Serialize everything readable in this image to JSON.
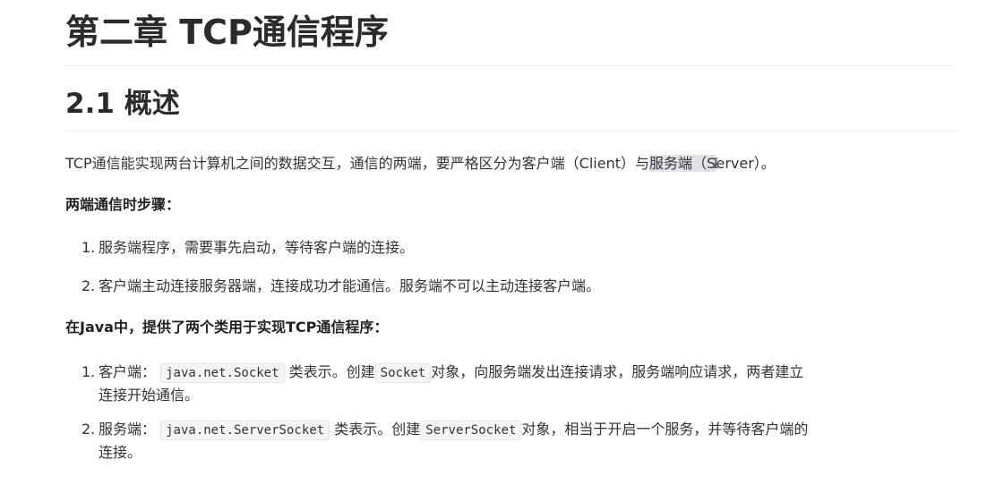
{
  "doc": {
    "chapter_title": "第二章 TCP通信程序",
    "section_title": "2.1 概述",
    "intro": {
      "before": "TCP通信能实现两台计算机之间的数据交互，通信的两端，要严格区分为客户端（Client）与",
      "highlight": "服务端（S",
      "cursor": "I",
      "after": "erver）。"
    },
    "steps_heading": "两端通信时步骤：",
    "steps": [
      {
        "num": "1.",
        "text": "服务端程序，需要事先启动，等待客户端的连接。"
      },
      {
        "num": "2.",
        "text": "客户端主动连接服务器端，连接成功才能通信。服务端不可以主动连接客户端。"
      }
    ],
    "java_heading": "在Java中，提供了两个类用于实现TCP通信程序：",
    "java_items": [
      {
        "num": "1.",
        "prefix": "客户端：",
        "code1": "java.net.Socket",
        "mid": "类表示。创建",
        "code2": "Socket",
        "line1_rest": "对象，向服务端发出连接请求，服务端响应请求，两者建立",
        "line2": "连接开始通信。"
      },
      {
        "num": "2.",
        "prefix": "服务端：",
        "code1": "java.net.ServerSocket",
        "mid": "类表示。创建",
        "code2": "ServerSocket",
        "line1_rest": "对象，相当于开启一个服务，并等待客户端的",
        "line2": "连接。"
      }
    ]
  }
}
